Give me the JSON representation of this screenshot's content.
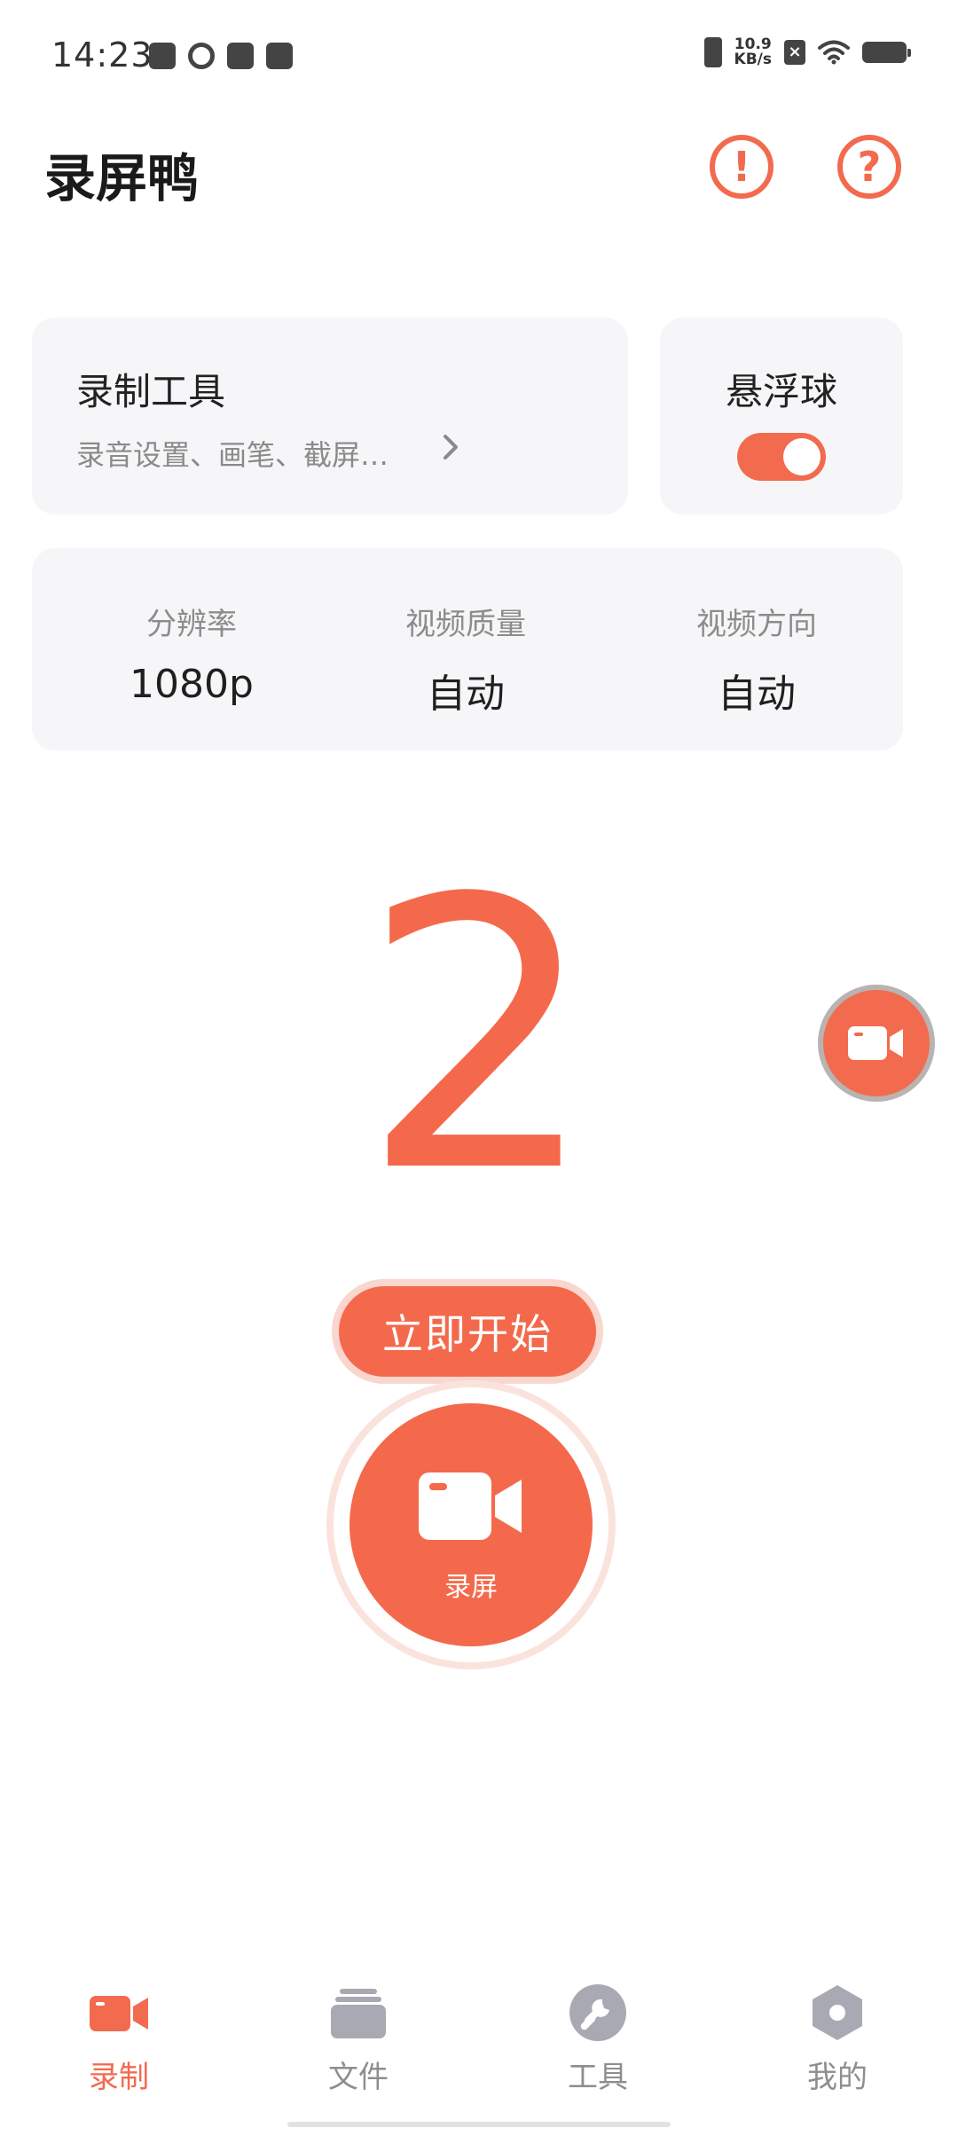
{
  "status_bar": {
    "time": "14:23",
    "net_speed_value": "10.9",
    "net_speed_unit": "KB/s",
    "x_badge": "×"
  },
  "header": {
    "title": "录屏鸭",
    "notice_glyph": "!",
    "help_glyph": "?"
  },
  "tools_card": {
    "title": "录制工具",
    "subtitle": "录音设置、画笔、截屏…"
  },
  "float_card": {
    "title": "悬浮球",
    "enabled": true
  },
  "settings": {
    "resolution_label": "分辨率",
    "resolution_value": "1080p",
    "quality_label": "视频质量",
    "quality_value": "自动",
    "direction_label": "视频方向",
    "direction_value": "自动"
  },
  "countdown": {
    "value": "2"
  },
  "start": {
    "label": "立即开始"
  },
  "record": {
    "label": "录屏"
  },
  "nav": {
    "items": [
      {
        "label": "录制",
        "icon": "video-camera-icon",
        "active": true
      },
      {
        "label": "文件",
        "icon": "folder-stack-icon",
        "active": false
      },
      {
        "label": "工具",
        "icon": "wrench-icon",
        "active": false
      },
      {
        "label": "我的",
        "icon": "hexagon-profile-icon",
        "active": false
      }
    ]
  },
  "colors": {
    "accent": "#F26B4F",
    "card_bg": "#F6F6F8",
    "inactive": "#A9A9B3"
  }
}
